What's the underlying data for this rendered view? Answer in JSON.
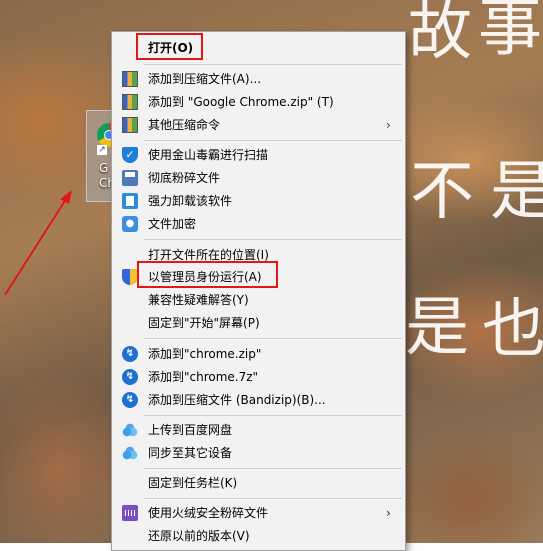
{
  "desktop": {
    "wallpaper_chars": [
      "故",
      "事",
      "不",
      "是",
      "是",
      "也"
    ],
    "shortcut_label": "G\nCh"
  },
  "context_menu": {
    "items": [
      {
        "label": "打开(O)",
        "bold": true,
        "icon": "none"
      },
      {
        "label": "添加到压缩文件(A)...",
        "icon": "archive-icon"
      },
      {
        "label": "添加到 \"Google Chrome.zip\" (T)",
        "icon": "archive-icon"
      },
      {
        "label": "其他压缩命令",
        "icon": "archive-icon",
        "submenu": true
      },
      {
        "label": "使用金山毒霸进行扫描",
        "icon": "shield-scan-icon"
      },
      {
        "label": "彻底粉碎文件",
        "icon": "shredder-icon"
      },
      {
        "label": "强力卸载该软件",
        "icon": "uninstall-icon"
      },
      {
        "label": "文件加密",
        "icon": "lock-icon"
      },
      {
        "label": "打开文件所在的位置(I)",
        "icon": "none"
      },
      {
        "label": "以管理员身份运行(A)",
        "icon": "uac-shield-icon"
      },
      {
        "label": "兼容性疑难解答(Y)",
        "icon": "none"
      },
      {
        "label": "固定到\"开始\"屏幕(P)",
        "icon": "none"
      },
      {
        "label": "添加到\"chrome.zip\"",
        "icon": "bandizip-icon"
      },
      {
        "label": "添加到\"chrome.7z\"",
        "icon": "bandizip-icon"
      },
      {
        "label": "添加到压缩文件 (Bandizip)(B)...",
        "icon": "bandizip-icon"
      },
      {
        "label": "上传到百度网盘",
        "icon": "baidu-cloud-icon"
      },
      {
        "label": "同步至其它设备",
        "icon": "baidu-cloud-icon"
      },
      {
        "label": "固定到任务栏(K)",
        "icon": "none"
      },
      {
        "label": "使用火绒安全粉碎文件",
        "icon": "huorong-icon",
        "submenu": true
      },
      {
        "label": "还原以前的版本(V)",
        "icon": "none"
      }
    ],
    "submenu_arrow": "›"
  },
  "colors": {
    "highlight": "#e01818",
    "menu_bg": "#f2f2f2"
  }
}
